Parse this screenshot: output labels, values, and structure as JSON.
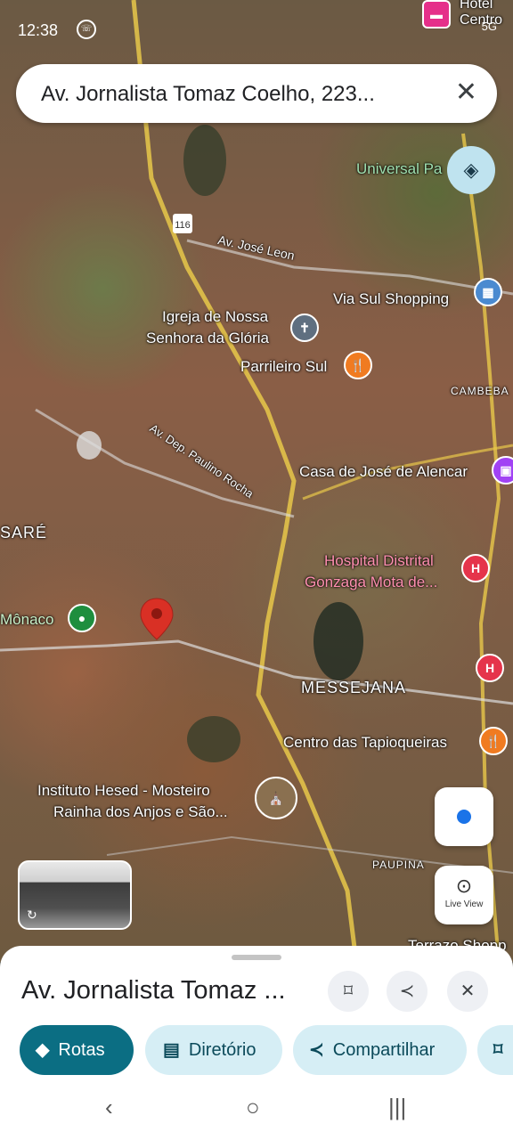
{
  "status_bar": {
    "time": "12:38",
    "indicators": "5G"
  },
  "search": {
    "query": "Av. Jornalista Tomaz Coelho, 223...",
    "close_icon": "close-icon"
  },
  "map": {
    "streets": [
      "Av. José Leon",
      "Av. Dep. Paulino Rocha",
      "116"
    ],
    "places": [
      {
        "name": "Universal Pa",
        "type": "green"
      },
      {
        "name": "Via Sul Shopping",
        "type": "shopping"
      },
      {
        "name": "Igreja de Nossa",
        "type": "church"
      },
      {
        "name": "Senhora da Glória",
        "type": "church"
      },
      {
        "name": "Parrileiro Sul",
        "type": "restaurant"
      },
      {
        "name": "CAMBEBA",
        "type": "district"
      },
      {
        "name": "Casa de José de Alencar",
        "type": "museum"
      },
      {
        "name": "SARÉ",
        "type": "district"
      },
      {
        "name": "Hospital Distrital",
        "type": "hospital"
      },
      {
        "name": "Gonzaga Mota de...",
        "type": "hospital"
      },
      {
        "name": "Mônaco",
        "type": "green"
      },
      {
        "name": "MESSEJANA",
        "type": "district"
      },
      {
        "name": "Centro das Tapioqueiras",
        "type": "restaurant"
      },
      {
        "name": "Instituto Hesed - Mosteiro",
        "type": "church"
      },
      {
        "name": "Rainha dos Anjos e São...",
        "type": "church"
      },
      {
        "name": "PAUPINA",
        "type": "district"
      },
      {
        "name": "Terrazo Shopp",
        "type": "shopping"
      },
      {
        "name": "Hotel",
        "type": "hotel"
      },
      {
        "name": "Centro",
        "type": "hotel"
      }
    ],
    "colors": {
      "pin": "#d93025",
      "restaurant": "#f07b21",
      "hospital": "#e5344b",
      "museum": "#a142f4",
      "green_poi": "#1e8e3e",
      "church": "#5f6f80"
    }
  },
  "controls": {
    "layers_icon": "layers-icon",
    "my_location_icon": "my-location-icon",
    "live_view_label": "Live View"
  },
  "sheet": {
    "title": "Av. Jornalista Tomaz ...",
    "save_icon": "bookmark-icon",
    "share_icon": "share-icon",
    "close_icon": "close-icon",
    "chips": [
      {
        "label": "Rotas",
        "icon": "directions-icon",
        "style": "primary"
      },
      {
        "label": "Diretório",
        "icon": "directory-icon",
        "style": "secondary"
      },
      {
        "label": "Compartilhar",
        "icon": "share-icon",
        "style": "secondary"
      },
      {
        "label": "",
        "icon": "bookmark-icon",
        "style": "secondary"
      }
    ]
  },
  "nav_bar": {
    "back": "‹",
    "home": "○",
    "recents": "|||"
  }
}
